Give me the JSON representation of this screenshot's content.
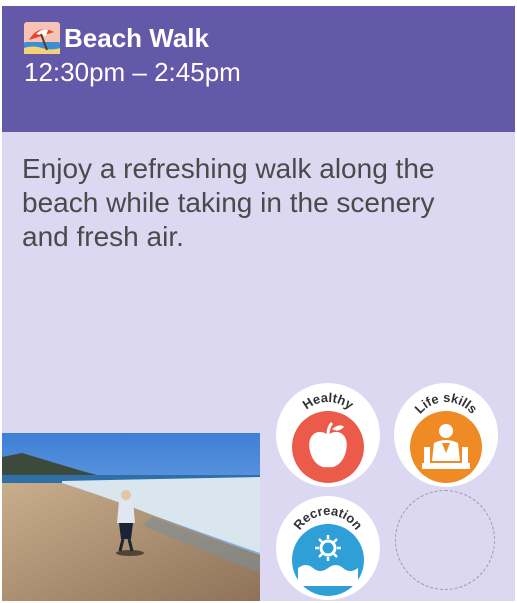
{
  "header": {
    "title": "Beach Walk",
    "time": "12:30pm – 2:45pm",
    "icon": "beach-umbrella-icon"
  },
  "description": "Enjoy a refreshing walk along the beach while taking in the scenery and fresh air.",
  "badges": [
    {
      "label": "Healthy",
      "icon": "apple-icon",
      "color": "#ec5a4a"
    },
    {
      "label": "Life skills",
      "icon": "person-lecturn-icon",
      "color": "#f08a24"
    },
    {
      "label": "Recreation",
      "icon": "sun-water-icon",
      "color": "#2f9fd8"
    }
  ],
  "colors": {
    "header_bg": "#6458a8",
    "card_bg": "#dcd8f2",
    "text": "#4a4a4a"
  }
}
